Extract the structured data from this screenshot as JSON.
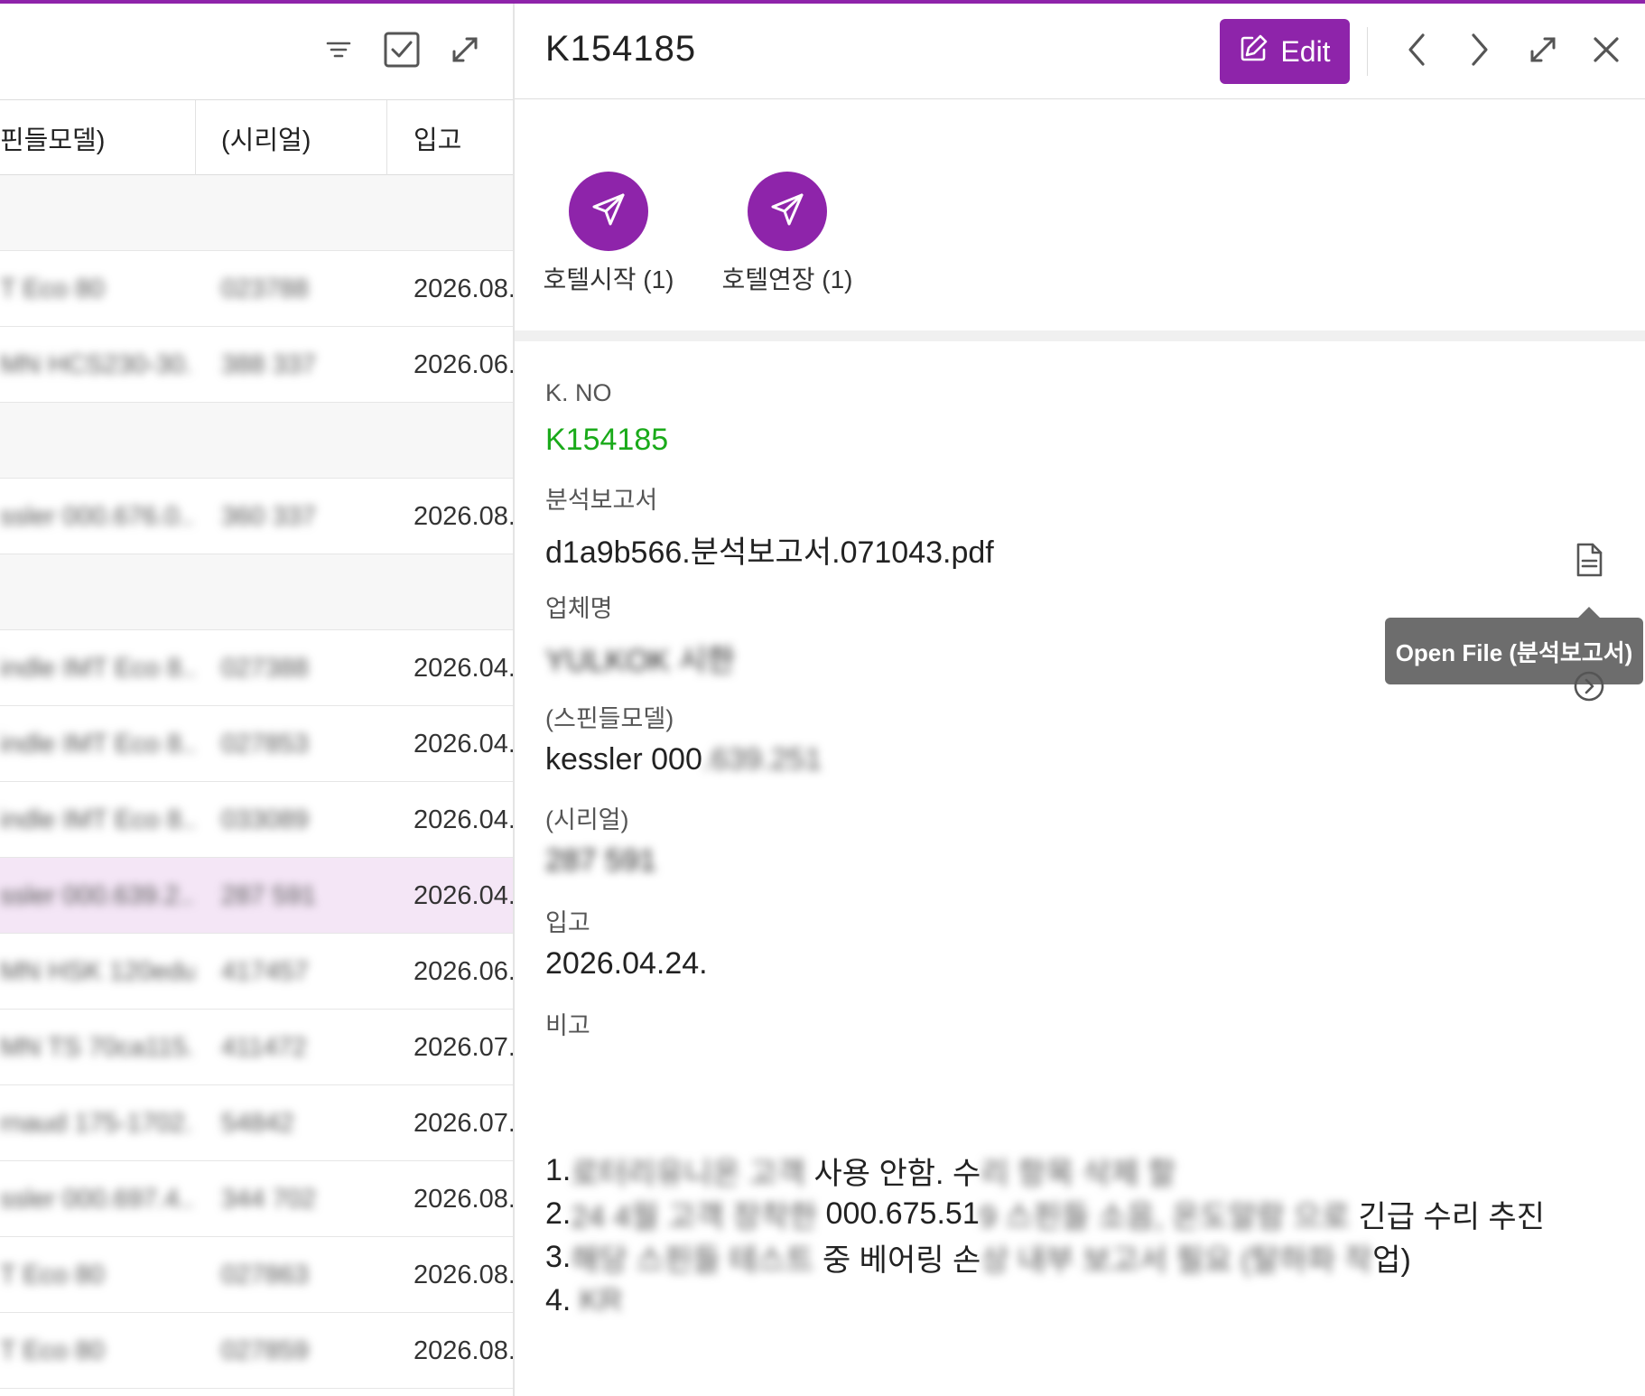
{
  "colors": {
    "accent": "#8e24aa",
    "green": "#1aaa1a",
    "tooltip": "#6d6d6d"
  },
  "left": {
    "toolbar": {
      "filter_icon": "filter-icon",
      "select_icon": "checkbox-icon",
      "expand_icon": "expand-icon"
    },
    "columns": [
      "핀들모델)",
      "(시리얼)",
      "입고"
    ],
    "rows": [
      {
        "type": "group"
      },
      {
        "model": "T Eco 80",
        "serial": "023788",
        "date": "2026.08."
      },
      {
        "model": "MN HCS230-30...",
        "serial": "388 337",
        "date": "2026.06."
      },
      {
        "type": "group"
      },
      {
        "model": "ssler 000.676.0...",
        "serial": "360 337",
        "date": "2026.08."
      },
      {
        "type": "group"
      },
      {
        "model": "indle IMT Eco 8...",
        "serial": "027388",
        "date": "2026.04."
      },
      {
        "model": "indle IMT Eco 8...",
        "serial": "027853",
        "date": "2026.04."
      },
      {
        "model": "indle IMT Eco 8...",
        "serial": "033089",
        "date": "2026.04."
      },
      {
        "model": "ssler 000.639.2...",
        "serial": "287 591",
        "date": "2026.04.",
        "selected": true
      },
      {
        "model": "MN HSK 120edu...",
        "serial": "417457",
        "date": "2026.06."
      },
      {
        "model": "MN TS 70ca115...",
        "serial": "411472",
        "date": "2026.07."
      },
      {
        "model": "rnaud 175-1702...",
        "serial": "54842",
        "date": "2026.07."
      },
      {
        "model": "ssler 000.697.4...",
        "serial": "344 702",
        "date": "2026.08."
      },
      {
        "model": "T Eco 80",
        "serial": "027863",
        "date": "2026.08."
      },
      {
        "model": "T Eco 80",
        "serial": "027859",
        "date": "2026.08."
      }
    ]
  },
  "detail": {
    "title": "K154185",
    "edit_label": "Edit",
    "actions": [
      {
        "label": "호텔시작 (1)"
      },
      {
        "label": "호텔연장 (1)"
      }
    ],
    "fields": {
      "kno": {
        "label": "K. NO",
        "value": "K154185"
      },
      "report": {
        "label": "분석보고서",
        "value": "d1a9b566.분석보고서.071043.pdf"
      },
      "company": {
        "label": "업체명",
        "value": "YULKOK 시한"
      },
      "spindle": {
        "label": "(스핀들모델)",
        "value_clear": "kessler 000",
        "value_blur": ".639.251"
      },
      "serial": {
        "label": "(시리얼)",
        "value": "287 591"
      },
      "intake": {
        "label": "입고",
        "value": "2026.04.24."
      },
      "remark_label": "비고"
    },
    "tooltip": "Open File (분석보고서)",
    "remarks": [
      {
        "prefix": "1.",
        "blur1": "로터리유니온 고객",
        "clear1": " 사용 안함. 수",
        "blur2": "리 항목 삭제 할",
        "clear2": ""
      },
      {
        "prefix": "2.",
        "blur1": "24 4월 고객 장착한",
        "clear1": " 000.675.51",
        "blur2": "9 스핀들 소음, 온도알람 으로",
        "clear2": " 긴급 수리 추진"
      },
      {
        "prefix": "3.",
        "blur1": "해당 스핀들 테스트",
        "clear1": " 중 베어링 손",
        "blur2": "상 내부 보고서 필요 (탈하파 작",
        "clear2": "업)"
      },
      {
        "prefix": "4.",
        "blur1": " KR",
        "clear1": "",
        "blur2": "",
        "clear2": ""
      }
    ]
  }
}
